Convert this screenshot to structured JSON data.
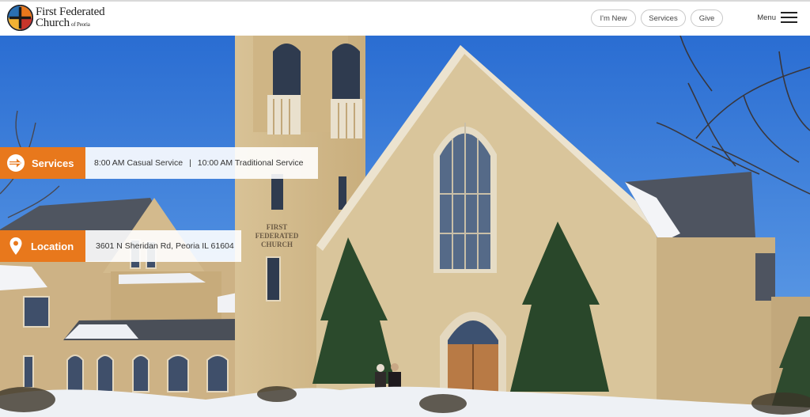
{
  "logo": {
    "line1": "First Federated",
    "line2": "Church",
    "sub": "of Peoria"
  },
  "nav": {
    "im_new": "I'm New",
    "services": "Services",
    "give": "Give",
    "menu": "Menu"
  },
  "services_bar": {
    "label": "Services",
    "service1": "8:00 AM Casual Service",
    "separator": "|",
    "service2": "10:00 AM Traditional Service"
  },
  "location_bar": {
    "label": "Location",
    "address": "3601 N Sheridan Rd, Peoria IL 61604"
  },
  "hero": {
    "tower_inscription": [
      "FIRST",
      "FEDERATED",
      "CHURCH"
    ]
  },
  "colors": {
    "accent_orange": "#e8781c",
    "sky": "#2f74d6",
    "brick": "#d2b98c"
  },
  "icons": [
    "church-logo-icon",
    "hamburger-menu-icon",
    "services-arrows-icon",
    "location-pin-icon"
  ]
}
